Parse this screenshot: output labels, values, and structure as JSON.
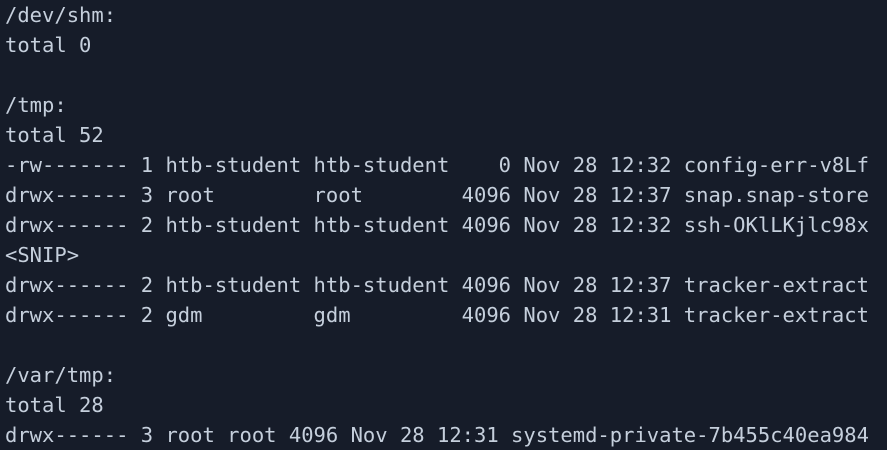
{
  "terminal": {
    "lines": [
      "/dev/shm:",
      "total 0",
      "",
      "/tmp:",
      "total 52",
      "-rw------- 1 htb-student htb-student    0 Nov 28 12:32 config-err-v8Lf",
      "drwx------ 3 root        root        4096 Nov 28 12:37 snap.snap-store",
      "drwx------ 2 htb-student htb-student 4096 Nov 28 12:32 ssh-OKlLKjlc98x",
      "<SNIP>",
      "drwx------ 2 htb-student htb-student 4096 Nov 28 12:37 tracker-extract",
      "drwx------ 2 gdm         gdm         4096 Nov 28 12:31 tracker-extract",
      "",
      "/var/tmp:",
      "total 28",
      "drwx------ 3 root root 4096 Nov 28 12:31 systemd-private-7b455c40ea984"
    ]
  }
}
